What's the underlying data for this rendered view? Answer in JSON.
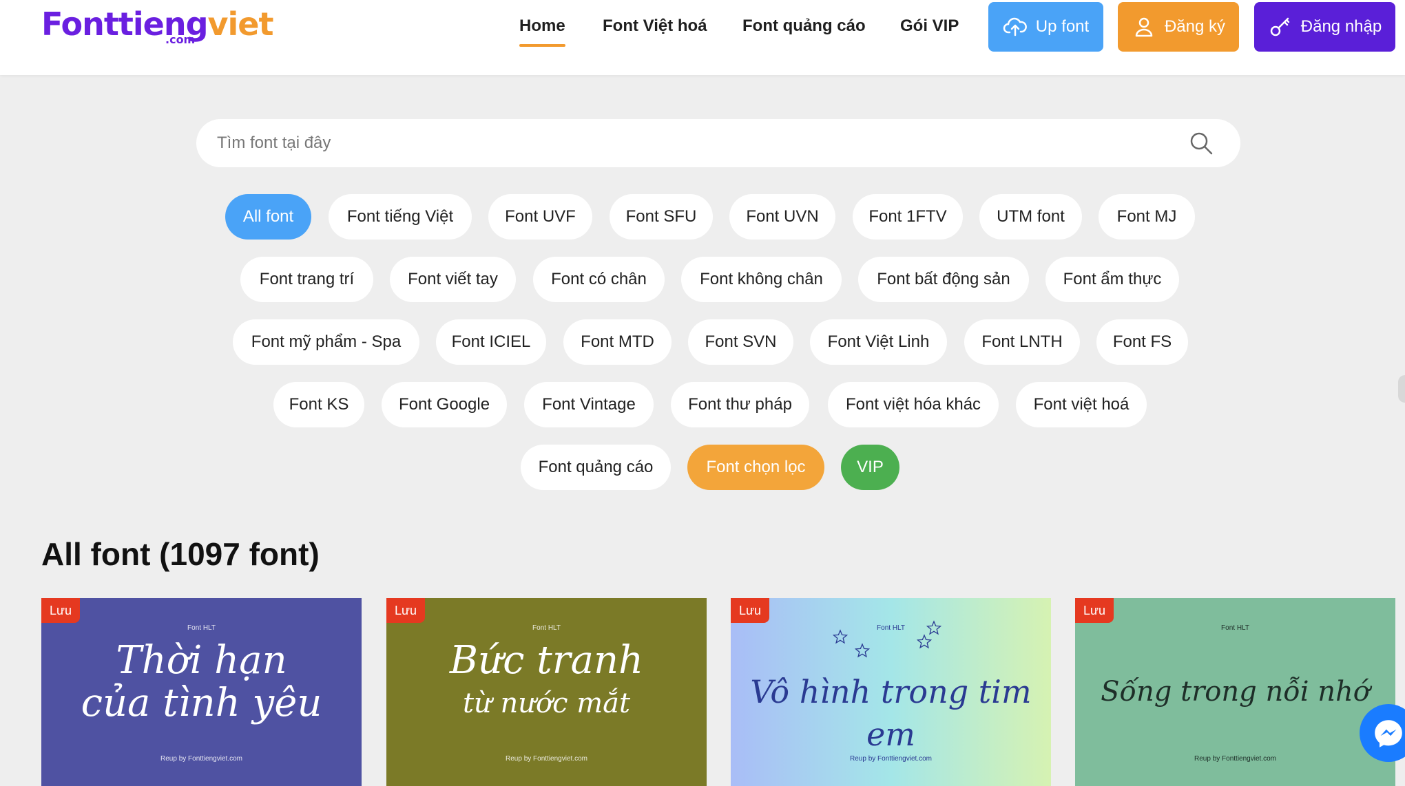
{
  "logo": {
    "part1": "Fonttieng",
    "part2": "viet",
    "suffix": ".com"
  },
  "nav": [
    "Home",
    "Font Việt hoá",
    "Font quảng cáo",
    "Gói VIP"
  ],
  "buttons": {
    "upload": "Up font",
    "register": "Đăng ký",
    "login": "Đăng nhập"
  },
  "colors": {
    "upload": "#4aa3f7",
    "register": "#f29a2e",
    "login": "#5a1fd8",
    "accent": "#f29a2e"
  },
  "search": {
    "placeholder": "Tìm font tại đây"
  },
  "chips": [
    [
      "All font",
      "Font tiếng Việt",
      "Font UVF",
      "Font SFU",
      "Font UVN",
      "Font 1FTV",
      "UTM font",
      "Font MJ"
    ],
    [
      "Font trang trí",
      "Font viết tay",
      "Font có chân",
      "Font không chân",
      "Font bất động sản",
      "Font ẩm thực"
    ],
    [
      "Font mỹ phẩm - Spa",
      "Font ICIEL",
      "Font MTD",
      "Font SVN",
      "Font Việt Linh",
      "Font LNTH",
      "Font FS"
    ],
    [
      "Font KS",
      "Font Google",
      "Font Vintage",
      "Font thư pháp",
      "Font việt hóa khác",
      "Font việt hoá"
    ],
    [
      "Font quảng cáo",
      "Font chọn lọc",
      "VIP"
    ]
  ],
  "section_title": "All font (1097 font)",
  "cards": [
    {
      "save": "Lưu",
      "top": "Font HLT",
      "line1": "Thời hạn",
      "line2": "của tình yêu",
      "bottom": "Reup by Fonttiengviet.com",
      "bg": "#4f52a2"
    },
    {
      "save": "Lưu",
      "top": "Font HLT",
      "line1": "Bức tranh",
      "line2": "từ nước mắt",
      "bottom": "Reup by Fonttiengviet.com",
      "bg": "#7b7a27"
    },
    {
      "save": "Lưu",
      "top": "Font HLT",
      "line1": "Vô hình trong tim em",
      "line2": "",
      "bottom": "Reup by Fonttiengviet.com",
      "bg": "gradient"
    },
    {
      "save": "Lưu",
      "top": "Font HLT",
      "line1": "Sống trong nỗi nhớ",
      "line2": "",
      "bottom": "Reup by Fonttiengviet.com",
      "bg": "#7fbd9c"
    }
  ]
}
